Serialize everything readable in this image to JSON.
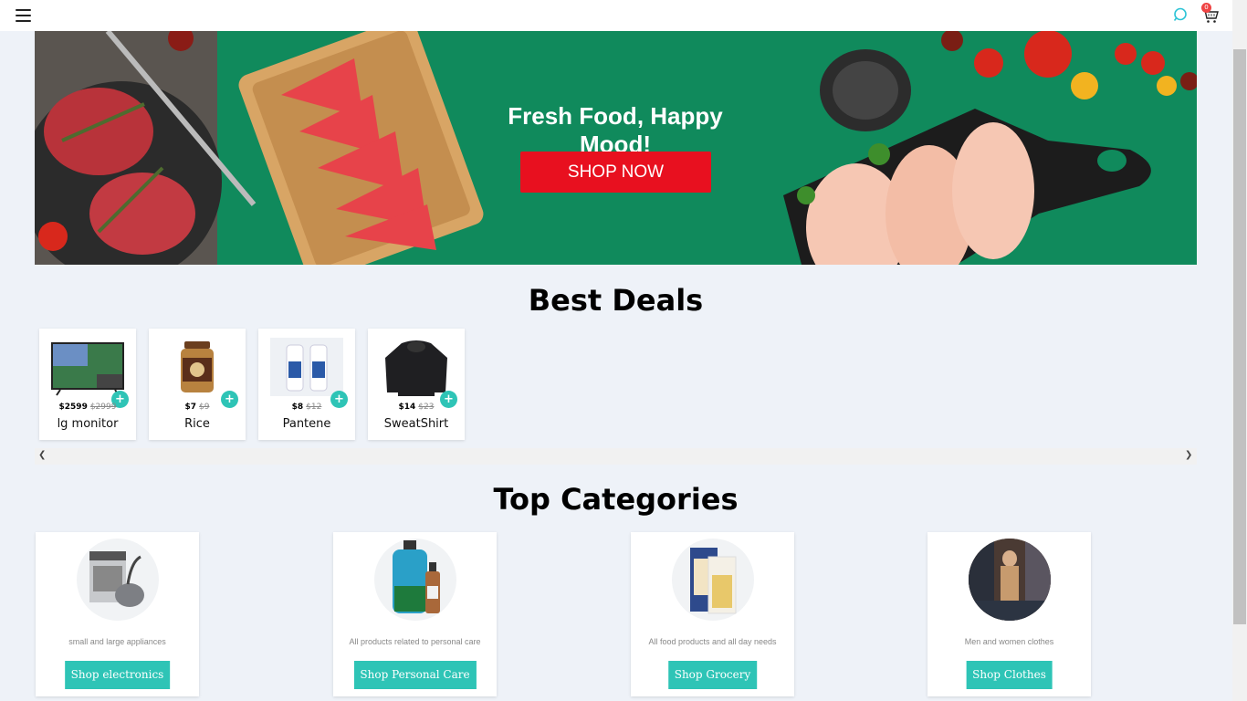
{
  "header": {
    "menu_icon": "hamburger-icon",
    "search_icon": "search-icon",
    "cart_icon": "cart-icon",
    "cart_count": "0"
  },
  "hero": {
    "title": "Fresh Food, Happy Mood!",
    "cta_label": "SHOP NOW",
    "background_color": "#108a5c",
    "cta_color": "#e8101f"
  },
  "deals": {
    "title": "Best Deals",
    "items": [
      {
        "name": "lg monitor",
        "price": "$2599",
        "old_price": "$2999"
      },
      {
        "name": "Rice",
        "price": "$7",
        "old_price": "$9"
      },
      {
        "name": "Pantene",
        "price": "$8",
        "old_price": "$12"
      },
      {
        "name": "SweatShirt",
        "price": "$14",
        "old_price": "$23"
      }
    ],
    "add_icon": "plus-icon",
    "scroll_left_icon": "chevron-left-icon",
    "scroll_right_icon": "chevron-right-icon"
  },
  "categories": {
    "title": "Top Categories",
    "items": [
      {
        "description": "small and large appliances",
        "button": "Shop electronics"
      },
      {
        "description": "All products related to personal care",
        "button": "Shop Personal Care"
      },
      {
        "description": "All food products and all day needs",
        "button": "Shop Grocery"
      },
      {
        "description": "Men and women clothes",
        "button": "Shop Clothes"
      }
    ]
  },
  "colors": {
    "accent": "#2ec4b6",
    "page_bg": "#eef2f8"
  }
}
